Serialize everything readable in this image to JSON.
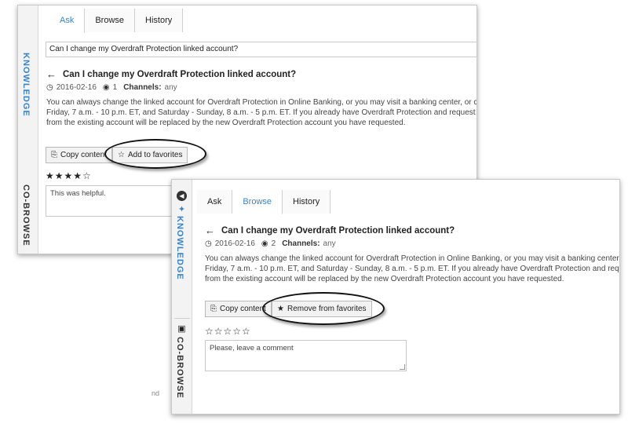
{
  "tabs": [
    "Ask",
    "Browse",
    "History"
  ],
  "back_panel": {
    "active_tab": "Ask",
    "rail": {
      "knowledge_label": "KNOWLEDGE",
      "cobrowse_label": "CO-BROWSE"
    },
    "question_input_value": "Can I change my Overdraft Protection linked account?",
    "article_title": "Can I change my Overdraft Protection linked account?",
    "date": "2016-02-16",
    "views": "1",
    "channels_label": "Channels:",
    "channels_value": "any",
    "body_lines": [
      "You can always change the linked account for Overdraft Protection in Online Banking, or you may visit a banking center, or call",
      "Friday, 7 a.m. - 10 p.m. ET, and Saturday - Sunday, 8 a.m. - 5 p.m. ET. If you already have Overdraft Protection and request that",
      "from the existing account will be replaced by the new Overdraft Protection account you have requested."
    ],
    "copy_button": "Copy content",
    "favorite_button": "Add to favorites",
    "rating_stars": "★★★★☆",
    "comment_value": "This was helpful."
  },
  "front_panel": {
    "active_tab": "Browse",
    "rail": {
      "knowledge_label": "KNOWLEDGE",
      "cobrowse_label": "CO-BROWSE"
    },
    "article_title": "Can I change my Overdraft Protection linked account?",
    "date": "2016-02-16",
    "views": "2",
    "channels_label": "Channels:",
    "channels_value": "any",
    "body_lines": [
      "You can always change the linked account for Overdraft Protection in Online Banking, or you may visit a banking center, o",
      "Friday, 7 a.m. - 10 p.m. ET, and Saturday - Sunday, 8 a.m. - 5 p.m. ET. If you already have Overdraft Protection and request",
      "from the existing account will be replaced by the new Overdraft Protection account you have requested."
    ],
    "copy_button": "Copy content",
    "favorite_button": "Remove from favorites",
    "rating_stars": "☆☆☆☆☆",
    "comment_placeholder": "Please, leave a comment"
  },
  "fragment_text": "nd",
  "colors": {
    "accent": "#3b83c7",
    "border": "#c9c9c9"
  },
  "icons": {
    "back": "arrow-left-icon",
    "date": "clock-icon",
    "views": "eye-icon",
    "copy": "copy-icon",
    "add_favorite": "star-outline-icon",
    "remove_favorite": "star-filled-icon"
  }
}
